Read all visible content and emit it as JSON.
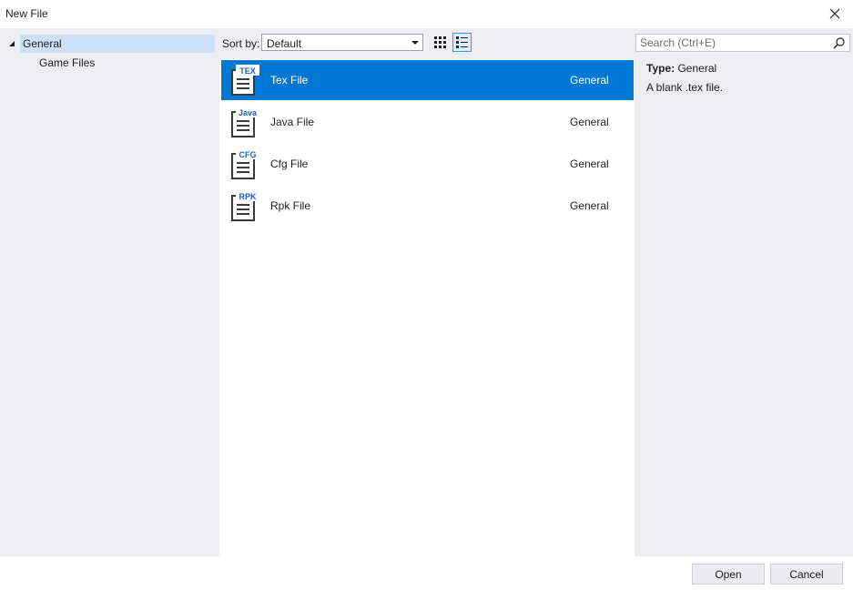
{
  "window": {
    "title": "New File"
  },
  "tree": {
    "items": [
      {
        "label": "General",
        "selected": true,
        "expanded": true
      },
      {
        "label": "Game Files",
        "selected": false
      }
    ]
  },
  "toolbar": {
    "sort_label": "Sort by:",
    "sort_value": "Default"
  },
  "list": {
    "items": [
      {
        "badge": "TEX",
        "name": "Tex File",
        "category": "General",
        "selected": true
      },
      {
        "badge": "Java",
        "name": "Java File",
        "category": "General",
        "selected": false
      },
      {
        "badge": "CFG",
        "name": "Cfg File",
        "category": "General",
        "selected": false
      },
      {
        "badge": "RPK",
        "name": "Rpk File",
        "category": "General",
        "selected": false
      }
    ]
  },
  "details": {
    "search_placeholder": "Search (Ctrl+E)",
    "type_label": "Type:",
    "type_value": "General",
    "description": "A blank .tex file."
  },
  "buttons": {
    "open": "Open",
    "cancel": "Cancel"
  },
  "colors": {
    "accent": "#0078d4",
    "tree_selected": "#cce0f7",
    "panel": "#eeeef2"
  }
}
